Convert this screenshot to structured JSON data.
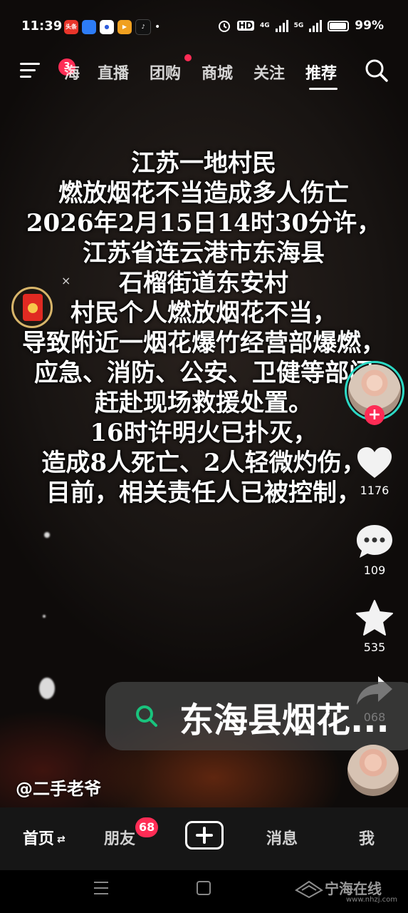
{
  "status_bar": {
    "time": "11:39",
    "notif_apps": [
      "头条",
      "browser-icon",
      "baidu-icon",
      "video-app-icon",
      "tiktok-icon"
    ],
    "dot": "•",
    "hd": "HD",
    "net4g": "4G",
    "net5g": "5G",
    "battery": "99%"
  },
  "top_nav": {
    "menu_badge": "3",
    "tabs": [
      "海",
      "直播",
      "团购",
      "商城",
      "关注",
      "推荐"
    ],
    "active_tab": "推荐"
  },
  "overlay": {
    "lines": [
      "江苏一地村民",
      "燃放烟花不当造成多人伤亡",
      "2026年2月15日14时30分许，",
      "江苏省连云港市东海县",
      "石榴街道东安村",
      "村民个人燃放烟花不当，",
      "导致附近一烟花爆竹经营部爆燃，",
      "应急、消防、公安、卫健等部门",
      "赶赴现场救援处置。",
      "16时许明火已扑灭，",
      "造成8人死亡、2人轻微灼伤，",
      "目前，相关责任人已被控制，"
    ]
  },
  "redpack": {
    "close": "×"
  },
  "sidebar": {
    "follow": "+",
    "like_count": "1176",
    "comment_count": "109",
    "favorite_count": "535",
    "share_count": "068"
  },
  "search_suggestion": {
    "text": "东海县烟花..."
  },
  "author": {
    "handle": "@二手老爷"
  },
  "bottom_nav": {
    "home": "首页",
    "friends": "朋友",
    "friends_badge": "68",
    "messages": "消息",
    "me": "我"
  },
  "watermark": {
    "title": "宁海在线",
    "url": "www.nhzj.com"
  },
  "colors": {
    "accent": "#fe2c55",
    "ring": "#2bd9c5",
    "search_green": "#19c37d"
  }
}
